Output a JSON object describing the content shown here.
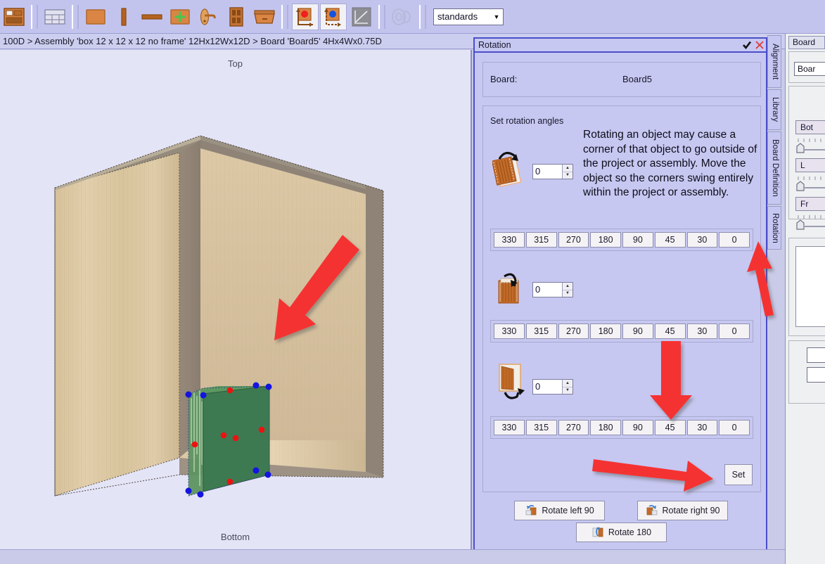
{
  "toolbar": {
    "icons": [
      {
        "name": "drawer-stack-icon",
        "label": "Cabinet"
      },
      {
        "name": "grid-layout-icon",
        "label": "Layout"
      },
      {
        "name": "panel-icon",
        "label": "Panel"
      },
      {
        "name": "vertical-board-icon",
        "label": "Vertical Board"
      },
      {
        "name": "horizontal-board-icon",
        "label": "Horizontal Board"
      },
      {
        "name": "add-panel-icon",
        "label": "Add Panel"
      },
      {
        "name": "handle-icon",
        "label": "Handle"
      },
      {
        "name": "door-icon",
        "label": "Door"
      },
      {
        "name": "drawer-icon",
        "label": "Drawer"
      },
      {
        "name": "red-point-origin-icon",
        "label": "Origin Red"
      },
      {
        "name": "blue-point-origin-icon",
        "label": "Origin Blue"
      },
      {
        "name": "measure-angle-icon",
        "label": "Angle"
      },
      {
        "name": "tape-measure-icon",
        "label": "Measure"
      }
    ],
    "dropdown": {
      "value": "standards",
      "options": [
        "standards"
      ]
    }
  },
  "breadcrumb": {
    "text": "100D > Assembly 'box 12 x 12 x 12 no frame' 12Hx12Wx12D > Board 'Board5' 4Hx4Wx0.75D"
  },
  "viewport": {
    "top_label": "Top",
    "bottom_label": "Bottom",
    "selection_color": "#3b7a4f",
    "handle_corner_color": "#1414e0",
    "handle_center_color": "#ee1111"
  },
  "rotation_panel": {
    "title": "Rotation",
    "accept_icon": "checkmark-icon",
    "close_icon": "close-icon",
    "board_group": {
      "label": "Board:",
      "value": "Board5"
    },
    "angles_group": {
      "label": "Set rotation angles",
      "notice": "Rotating an object may cause a corner of that object to go outside of the project or assembly. Move the object so the corners swing entirely within the project or assembly.",
      "rows": [
        {
          "icon": "rotate-face-icon",
          "spin_value": "0",
          "buttons": [
            "330",
            "315",
            "270",
            "180",
            "90",
            "45",
            "30",
            "0"
          ]
        },
        {
          "icon": "rotate-top-icon",
          "spin_value": "0",
          "buttons": [
            "330",
            "315",
            "270",
            "180",
            "90",
            "45",
            "30",
            "0"
          ]
        },
        {
          "icon": "rotate-side-icon",
          "spin_value": "0",
          "buttons": [
            "330",
            "315",
            "270",
            "180",
            "90",
            "45",
            "30",
            "0"
          ]
        }
      ],
      "set_label": "Set"
    },
    "quick_buttons": [
      {
        "label": "Rotate left 90",
        "icon": "rotate-left-icon"
      },
      {
        "label": "Rotate right 90",
        "icon": "rotate-right-icon"
      },
      {
        "label": "Rotate 180",
        "icon": "rotate-180-icon"
      }
    ]
  },
  "vertical_tabs": [
    {
      "label": "Alignment"
    },
    {
      "label": "Library"
    },
    {
      "label": "Board Definition"
    },
    {
      "label": "Rotation"
    }
  ],
  "far_right_panel": {
    "tab_label": "Board",
    "name_field": "Boar",
    "buttons": [
      "Bot",
      "L",
      "Fr"
    ]
  },
  "annotations": {
    "arrow_color": "#f53232",
    "arrows": [
      {
        "name": "arrow-to-selected-board"
      },
      {
        "name": "arrow-to-45-button"
      },
      {
        "name": "arrow-to-set-button"
      },
      {
        "name": "arrow-to-rotation-tab"
      }
    ]
  }
}
